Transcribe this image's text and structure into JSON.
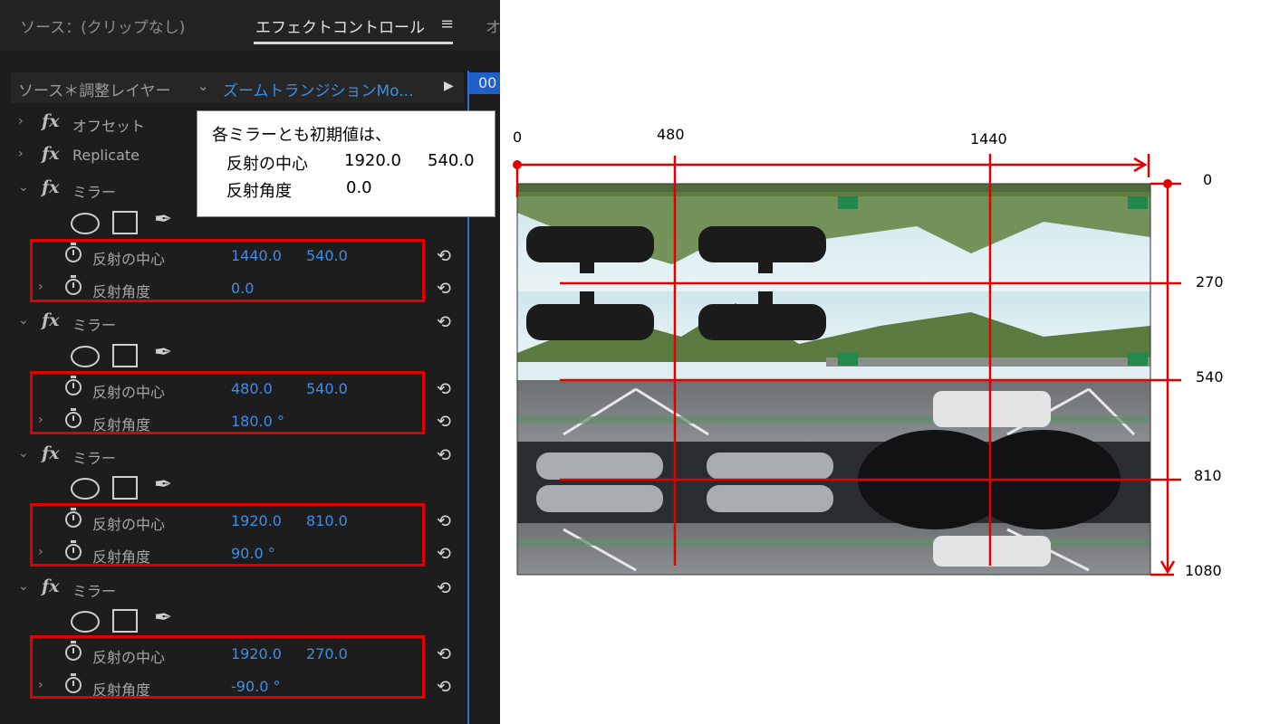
{
  "tabs": {
    "source": "ソース：(クリップなし)",
    "effect_controls": "エフェクトコントロール",
    "menu_icon": "≡",
    "next_tab": "オ"
  },
  "source_bar": {
    "clip": "ソース＊調整レイヤー",
    "chevron": "⌄",
    "sequence": "ズームトランジションMo...",
    "play_icon": "▶",
    "timecode": "00"
  },
  "effects": [
    {
      "name": "オフセット",
      "fx": "fx",
      "chevron": "›"
    },
    {
      "name": "Replicate",
      "fx": "fx",
      "chevron": "›"
    }
  ],
  "mirrors": [
    {
      "name": "ミラー",
      "fx": "fx",
      "chevron": "⌄",
      "center_label": "反射の中心",
      "angle_label": "反射角度",
      "center_x": "1440.0",
      "center_y": "540.0",
      "angle": "0.0"
    },
    {
      "name": "ミラー",
      "fx": "fx",
      "chevron": "⌄",
      "center_label": "反射の中心",
      "angle_label": "反射角度",
      "center_x": "480.0",
      "center_y": "540.0",
      "angle": "180.0 °"
    },
    {
      "name": "ミラー",
      "fx": "fx",
      "chevron": "⌄",
      "center_label": "反射の中心",
      "angle_label": "反射角度",
      "center_x": "1920.0",
      "center_y": "810.0",
      "angle": "90.0 °"
    },
    {
      "name": "ミラー",
      "fx": "fx",
      "chevron": "⌄",
      "center_label": "反射の中心",
      "angle_label": "反射角度",
      "center_x": "1920.0",
      "center_y": "270.0",
      "angle": "-90.0 °"
    }
  ],
  "icons": {
    "reset": "⟲",
    "expand": "›",
    "pen": "✒"
  },
  "note": {
    "line1": "各ミラーとも初期値は、",
    "center_label": "反射の中心",
    "center_x": "1920.0",
    "center_y": "540.0",
    "angle_label": "反射角度",
    "angle": "0.0"
  },
  "diagram": {
    "x_labels": [
      "0",
      "480",
      "1440"
    ],
    "y_labels": [
      "0",
      "270",
      "540",
      "810",
      "1080"
    ],
    "colors": {
      "annotation": "#e00000"
    }
  }
}
